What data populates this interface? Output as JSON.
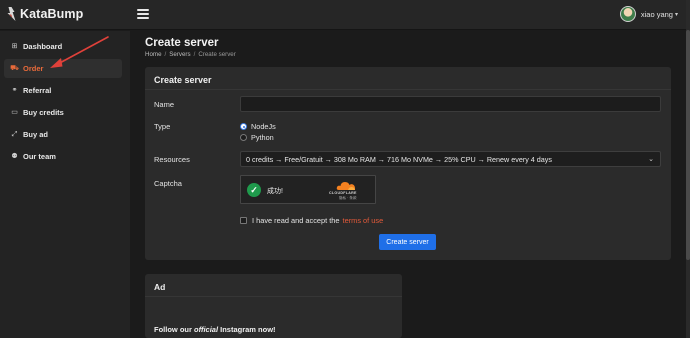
{
  "app": {
    "name": "KataBump"
  },
  "user": {
    "name": "xiao yang",
    "caret": "▾"
  },
  "sidebar": {
    "items": [
      {
        "icon": "⊞",
        "label": "Dashboard"
      },
      {
        "icon": "⛟",
        "label": "Order"
      },
      {
        "icon": "⚭",
        "label": "Referral"
      },
      {
        "icon": "▭",
        "label": "Buy credits"
      },
      {
        "icon": "⤢",
        "label": "Buy ad"
      },
      {
        "icon": "⚉",
        "label": "Our team"
      }
    ],
    "active_label": "Order"
  },
  "page": {
    "title": "Create server",
    "breadcrumb": [
      "Home",
      "Servers",
      "Create server"
    ],
    "breadcrumb_sep": "/"
  },
  "form": {
    "card_title": "Create server",
    "name_label": "Name",
    "name_value": "",
    "type_label": "Type",
    "type_options": [
      "NodeJs",
      "Python"
    ],
    "type_selected": "NodeJs",
    "resources_label": "Resources",
    "resources_value": "0 credits → Free/Gratuit → 308 Mo RAM → 716 Mo NVMe → 25% CPU → Renew every 4 days",
    "captcha_label": "Captcha",
    "captcha_status": "成功!",
    "captcha_brand": "CLOUDFLARE",
    "captcha_links": "隐私 · 条款",
    "terms_text": "I have read and accept the",
    "terms_link": "terms of use",
    "terms_checked": false,
    "submit_label": "Create server"
  },
  "ad": {
    "title": "Ad",
    "text_prefix": "Follow our ",
    "text_emphasis": "official",
    "text_suffix": " Instagram now!"
  },
  "colors": {
    "accent_orange": "#e86a3a",
    "primary_blue": "#1f6fe8",
    "annotation_red": "#e0413a",
    "success_green": "#1f9a4c",
    "cloudflare_orange": "#f48120"
  }
}
